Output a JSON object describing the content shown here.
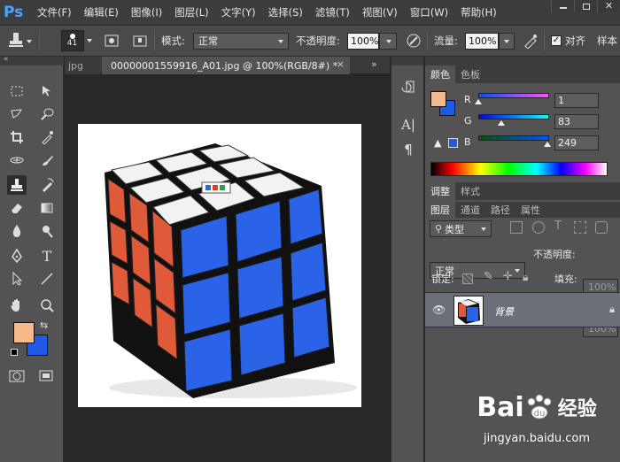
{
  "app": {
    "logo": "Ps"
  },
  "menubar": {
    "items": [
      "文件(F)",
      "编辑(E)",
      "图像(I)",
      "图层(L)",
      "文字(Y)",
      "选择(S)",
      "滤镜(T)",
      "视图(V)",
      "窗口(W)",
      "帮助(H)"
    ]
  },
  "options": {
    "brush_size": "41",
    "mode_label": "模式:",
    "mode_value": "正常",
    "opacity_label": "不透明度:",
    "opacity_value": "100%",
    "flow_label": "流量:",
    "flow_value": "100%",
    "aligned_label": "对齐",
    "aligned_checked": true,
    "sample_label": "样本"
  },
  "tabs": {
    "prev_doc": "jpg",
    "active_doc": "00000001559916_A01.jpg @ 100%(RGB/8#) *",
    "close": "×",
    "overflow": "»"
  },
  "colors": {
    "foreground": "#f5b98a",
    "background": "#1e5ae6",
    "accent": "#4aa3ff"
  },
  "color_panel": {
    "tabs": [
      "颜色",
      "色板"
    ],
    "r_label": "R",
    "r_value": "1",
    "r_level": 0.004,
    "g_label": "G",
    "g_value": "83",
    "g_level": 0.325,
    "b_label": "B",
    "b_value": "249",
    "b_level": 0.976
  },
  "adjust_panel": {
    "tabs": [
      "调整",
      "样式"
    ]
  },
  "layers_panel": {
    "tabs": [
      "图层",
      "通道",
      "路径",
      "属性"
    ],
    "kind_label": "类型",
    "blend_value": "正常",
    "opacity_label": "不透明度:",
    "opacity_value": "100%",
    "lock_label": "锁定:",
    "fill_label": "填充:",
    "fill_value": "100%",
    "layers": [
      {
        "name": "背景",
        "visible": true,
        "locked": true
      }
    ]
  },
  "watermark": {
    "brand": "Bai",
    "brand2": "经验",
    "url": "jingyan.baidu.com"
  }
}
